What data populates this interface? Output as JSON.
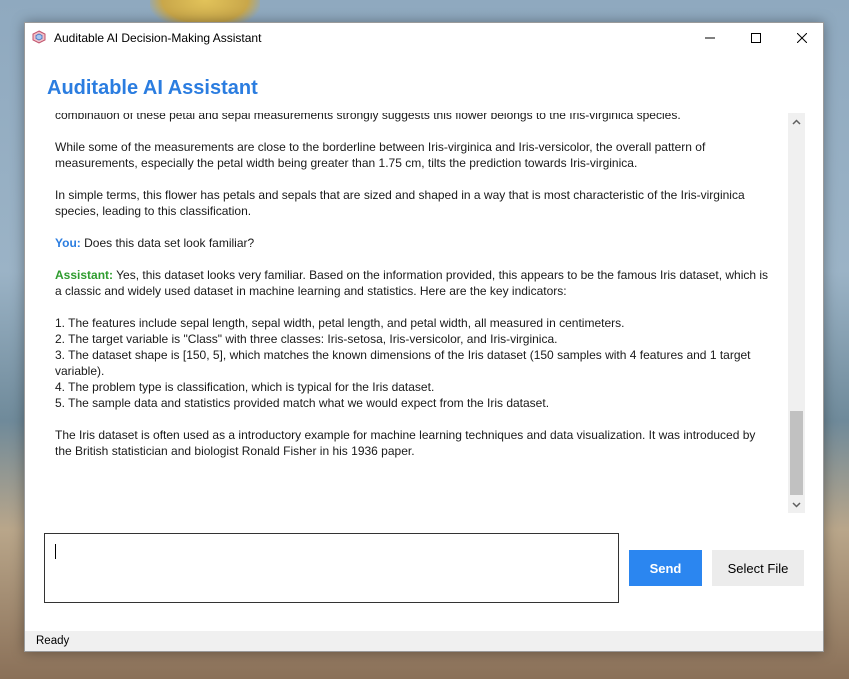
{
  "window": {
    "title": "Auditable AI Decision-Making Assistant",
    "controls": {
      "minimize": "—",
      "maximize": "☐",
      "close": "✕"
    }
  },
  "app": {
    "heading": "Auditable AI Assistant",
    "accent_color": "#2b7de0",
    "assistant_color": "#2e9c2e"
  },
  "chat": {
    "p0": "combination of these petal and sepal measurements strongly suggests this flower belongs to the Iris-virginica species.",
    "p1": "While some of the measurements are close to the borderline between Iris-virginica and Iris-versicolor, the overall pattern of measurements, especially the petal width being greater than 1.75 cm, tilts the prediction towards Iris-virginica.",
    "p2": "In simple terms, this flower has petals and sepals that are sized and shaped in a way that is most characteristic of the Iris-virginica species, leading to this classification.",
    "you_label": "You:",
    "you_text": " Does this data set look familiar?",
    "assistant_label": "Assistant:",
    "assistant_text": " Yes, this dataset looks very familiar. Based on the information provided, this appears to be the famous Iris dataset, which is a classic and widely used dataset in machine learning and statistics. Here are the key indicators:",
    "items": [
      "1. The features include sepal length, sepal width, petal length, and petal width, all measured in centimeters.",
      "2. The target variable is \"Class\" with three classes: Iris-setosa, Iris-versicolor, and Iris-virginica.",
      "3. The dataset shape is [150, 5], which matches the known dimensions of the Iris dataset (150 samples with 4 features and 1 target variable).",
      "4. The problem type is classification, which is typical for the Iris dataset.",
      "5. The sample data and statistics provided match what we would expect from the Iris dataset."
    ],
    "closing": "The Iris dataset is often used as a introductory example for machine learning techniques and data visualization. It was introduced by the British statistician and biologist Ronald Fisher in his 1936 paper."
  },
  "input": {
    "value": ""
  },
  "buttons": {
    "send": "Send",
    "select_file": "Select File",
    "send_color": "#2b86f0"
  },
  "status": {
    "text": "Ready"
  }
}
